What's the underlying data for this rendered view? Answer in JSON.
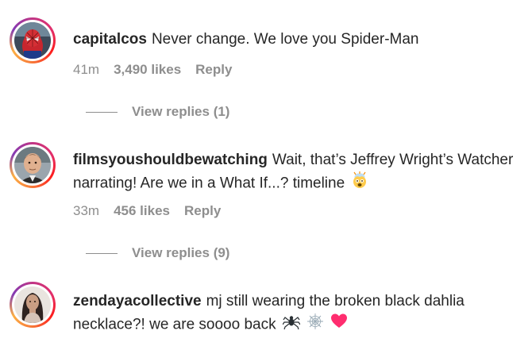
{
  "comments": [
    {
      "username": "capitalcos",
      "text": "Never change. We love you Spider-Man",
      "time": "41m",
      "likes": "3,490 likes",
      "reply_label": "Reply",
      "view_replies": "View replies (1)",
      "avatar_icon": "spiderman-avatar"
    },
    {
      "username": "filmsyoushouldbewatching",
      "text": "Wait, that’s Jeffrey Wright’s Watcher narrating! Are we in a What If...? timeline",
      "emoji": [
        "exploding-head-icon"
      ],
      "time": "33m",
      "likes": "456 likes",
      "reply_label": "Reply",
      "view_replies": "View replies (9)",
      "avatar_icon": "man-avatar"
    },
    {
      "username": "zendayacollective",
      "text": "mj still wearing the broken black dahlia necklace?! we are soooo back",
      "emoji": [
        "spider-icon",
        "spider-web-icon",
        "heart-icon"
      ],
      "avatar_icon": "woman-avatar"
    }
  ],
  "colors": {
    "text": "#262626",
    "muted": "#8e8e8e",
    "heart": "#ff2d6f"
  }
}
